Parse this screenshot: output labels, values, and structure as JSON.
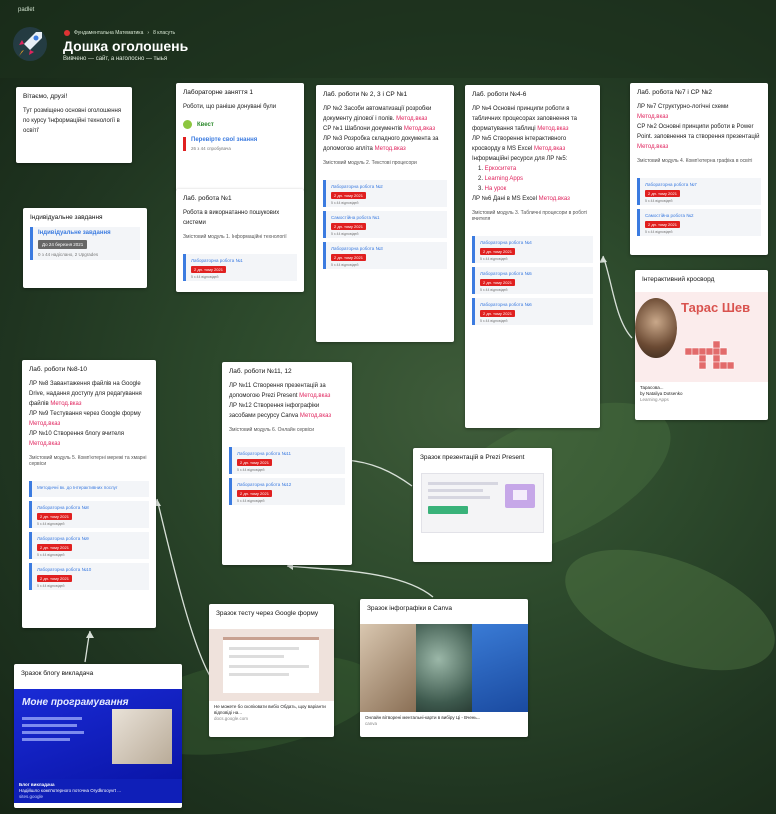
{
  "app": {
    "name": "padlet"
  },
  "breadcrumb": {
    "items": [
      "Фундаментальна Математика",
      "8 класуть"
    ]
  },
  "header": {
    "title": "Дошка оголошень",
    "subtitle": "Вивчено — сайт, а наголосно — тыья"
  },
  "cards": {
    "welcome": {
      "title": "Вітаємо, друзі!",
      "body": "Тут розміщено основні оголошення по курсу 'Інформаційні технології в освіті'"
    },
    "lab1": {
      "title": "Лабораторне заняття 1",
      "body": "Роботи, що раніше донувані були",
      "quest": "Квест",
      "check": "Перевірте свої знання",
      "check_meta": "26 з 44 спробувача"
    },
    "lab1b": {
      "title": "Лаб. робота №1",
      "body": "Робота в викорнатанно пошукових системи",
      "module": "Змістовий модуль 1. Інформаційні технології",
      "att_title": "Лабораторна робота №1",
      "att_badge": "2 дн. тому 2021",
      "att_meta": "5 з 44 відповідей"
    },
    "individual": {
      "title": "Індивідуальне завдання",
      "link": "Індивідуальне завдання",
      "date": "До 24 березня 2021",
      "meta": "0 з 44 надіслано, 2 Upgrades"
    },
    "lab23": {
      "title": "Лаб. роботи № 2, 3 і СР №1",
      "lines": [
        {
          "t": "ЛР №2 Засоби автоматизації розробки документу ділової і полів. ",
          "r": "Метод.вказ"
        },
        {
          "t": "СР №1 Шаблони документів ",
          "r": "Метод.вказ"
        },
        {
          "t": "ЛР №3 Розробка складного документа за допомогою апліта ",
          "r": "Метод.вказ"
        }
      ],
      "module": "Змістовий модуль 2. Текстові процесори",
      "atts": [
        {
          "t": "Лабораторна робота №2",
          "b": "2 дн. тому 2021",
          "m": "5 з 44 відповідей"
        },
        {
          "t": "Самостійна робота №1",
          "b": "2 дн. тому 2021",
          "m": "5 з 44 відповідей"
        },
        {
          "t": "Лабораторна робота №3",
          "b": "2 дн. тому 2021",
          "m": "5 з 44 відповідей"
        }
      ]
    },
    "lab46": {
      "title": "Лаб. роботи №4-6",
      "lines": [
        {
          "t": "ЛР №4 Основні принципи роботи в табличних процесорах заповнення та форматування таблиці ",
          "r": "Метод.вказ"
        },
        {
          "t": "ЛР №5 Створення інтерактивного кросворду в MS Excel ",
          "r": "Метод.вказ"
        },
        {
          "t": "Інформаційні ресурси для ЛР №5:",
          "r": ""
        }
      ],
      "resources": [
        "Eркоситета",
        "Learning Apps",
        "На урок"
      ],
      "tail": {
        "t": "ЛР №6 Дані в MS Excel ",
        "r": "Метод.вказ"
      },
      "module": "Змістовий модуль 3. Табличні процесори в роботі вчителя",
      "atts": [
        {
          "t": "Лабораторна робота №4",
          "b": "2 дн. тому 2021",
          "m": "5 з 44 відповідей"
        },
        {
          "t": "Лабораторна робота №5",
          "b": "2 дн. тому 2021",
          "m": "5 з 44 відповідей"
        },
        {
          "t": "Лабораторна робота №6",
          "b": "2 дн. тому 2021",
          "m": "5 з 44 відповідей"
        }
      ]
    },
    "lab7": {
      "title": "Лаб. робота №7 і СР №2",
      "lines": [
        {
          "t": "ЛР №7 Структурно-логічні схеми ",
          "r": "Метод.вказ"
        },
        {
          "t": "СР №2 Основні принципи роботи в Power Point. заповнення та створення презентацій ",
          "r": "Метод.вказ"
        }
      ],
      "module": "Змістовий модуль 4. Комп'ютерна графіка в освіті",
      "atts": [
        {
          "t": "Лабораторна робота №7",
          "b": "2 дн. тому 2021",
          "m": "5 з 44 відповідей"
        },
        {
          "t": "Самостійна робота №2",
          "b": "2 дн. тому 2021",
          "m": "5 з 44 відповідей"
        }
      ]
    },
    "crossword": {
      "title": "Інтерактивний кросворд",
      "banner": "Тарас Шев",
      "caption_title": "Тарасова...",
      "caption_sub": "by Nataliya Dotsenko",
      "caption_meta": "Learning Apps"
    },
    "lab810": {
      "title": "Лаб. роботи №8-10",
      "lines": [
        {
          "t": "ЛР №8 Завантаження файлів на Google Drive, надання доступу для редагування файлів ",
          "r": "Метод.вказ"
        },
        {
          "t": "ЛР №9 Тестування через Google форму ",
          "r": "Метод.вказ"
        },
        {
          "t": "ЛР №10 Створення блогу вчителя ",
          "r": "Метод.вказ"
        }
      ],
      "module": "Змістовий модуль 5. Комп'ютерні мережі та хмарні сервіси",
      "atts": [
        {
          "t": "Методичні вк. до Інтерактивних послуг",
          "b": "",
          "m": ""
        },
        {
          "t": "Лабораторна робота №8",
          "b": "2 дн. тому 2021",
          "m": "5 з 44 відповідей"
        },
        {
          "t": "Лабораторна робота №9",
          "b": "2 дн. тому 2021",
          "m": "5 з 44 відповідей"
        },
        {
          "t": "Лабораторна робота №10",
          "b": "2 дн. тому 2021",
          "m": "5 з 44 відповідей"
        }
      ]
    },
    "lab1112": {
      "title": "Лаб. роботи №11, 12",
      "lines": [
        {
          "t": "ЛР №11 Створення презентацій за допомогою Prezi Present ",
          "r": "Метод.вказ"
        },
        {
          "t": "ЛР №12 Створення інфографіки засобами ресурсу Canva ",
          "r": "Метод.вказ"
        }
      ],
      "module": "Змістовий модуль 6. Онлайн сервіси",
      "atts": [
        {
          "t": "Лабораторна робота №11",
          "b": "2 дн. тому 2021",
          "m": "5 з 44 відповідей"
        },
        {
          "t": "Лабораторна робота №12",
          "b": "2 дн. тому 2021",
          "m": "5 з 44 відповідей"
        }
      ]
    },
    "prezi": {
      "title": "Зразок презентацій в Prezi Present"
    },
    "gform": {
      "title": "Зразок тесту через Google форму",
      "caption": "Не можете бо скопіювати вибіо Обдать, щоу варіанти відповіді на...",
      "meta": "docs.google.com"
    },
    "canva": {
      "title": "Зразок інфографіки в Canva",
      "caption": "Онлайн вітворені ментальні-карти в вибіру Ці - Вчень...",
      "meta": "canva"
    },
    "blog": {
      "title": "Зразок блогу викладача",
      "banner": "Моне програмування",
      "caption_title": "Блог викладача",
      "caption_sub": "Надійшло комп'ютерного поточна Orydkrooyvrt ...",
      "caption_meta": "sites.google"
    }
  },
  "colors": {
    "accent_red": "#e0245e",
    "badge_red": "#e02020",
    "link_blue": "#3b7be0",
    "quest_green": "#8cc63f"
  }
}
